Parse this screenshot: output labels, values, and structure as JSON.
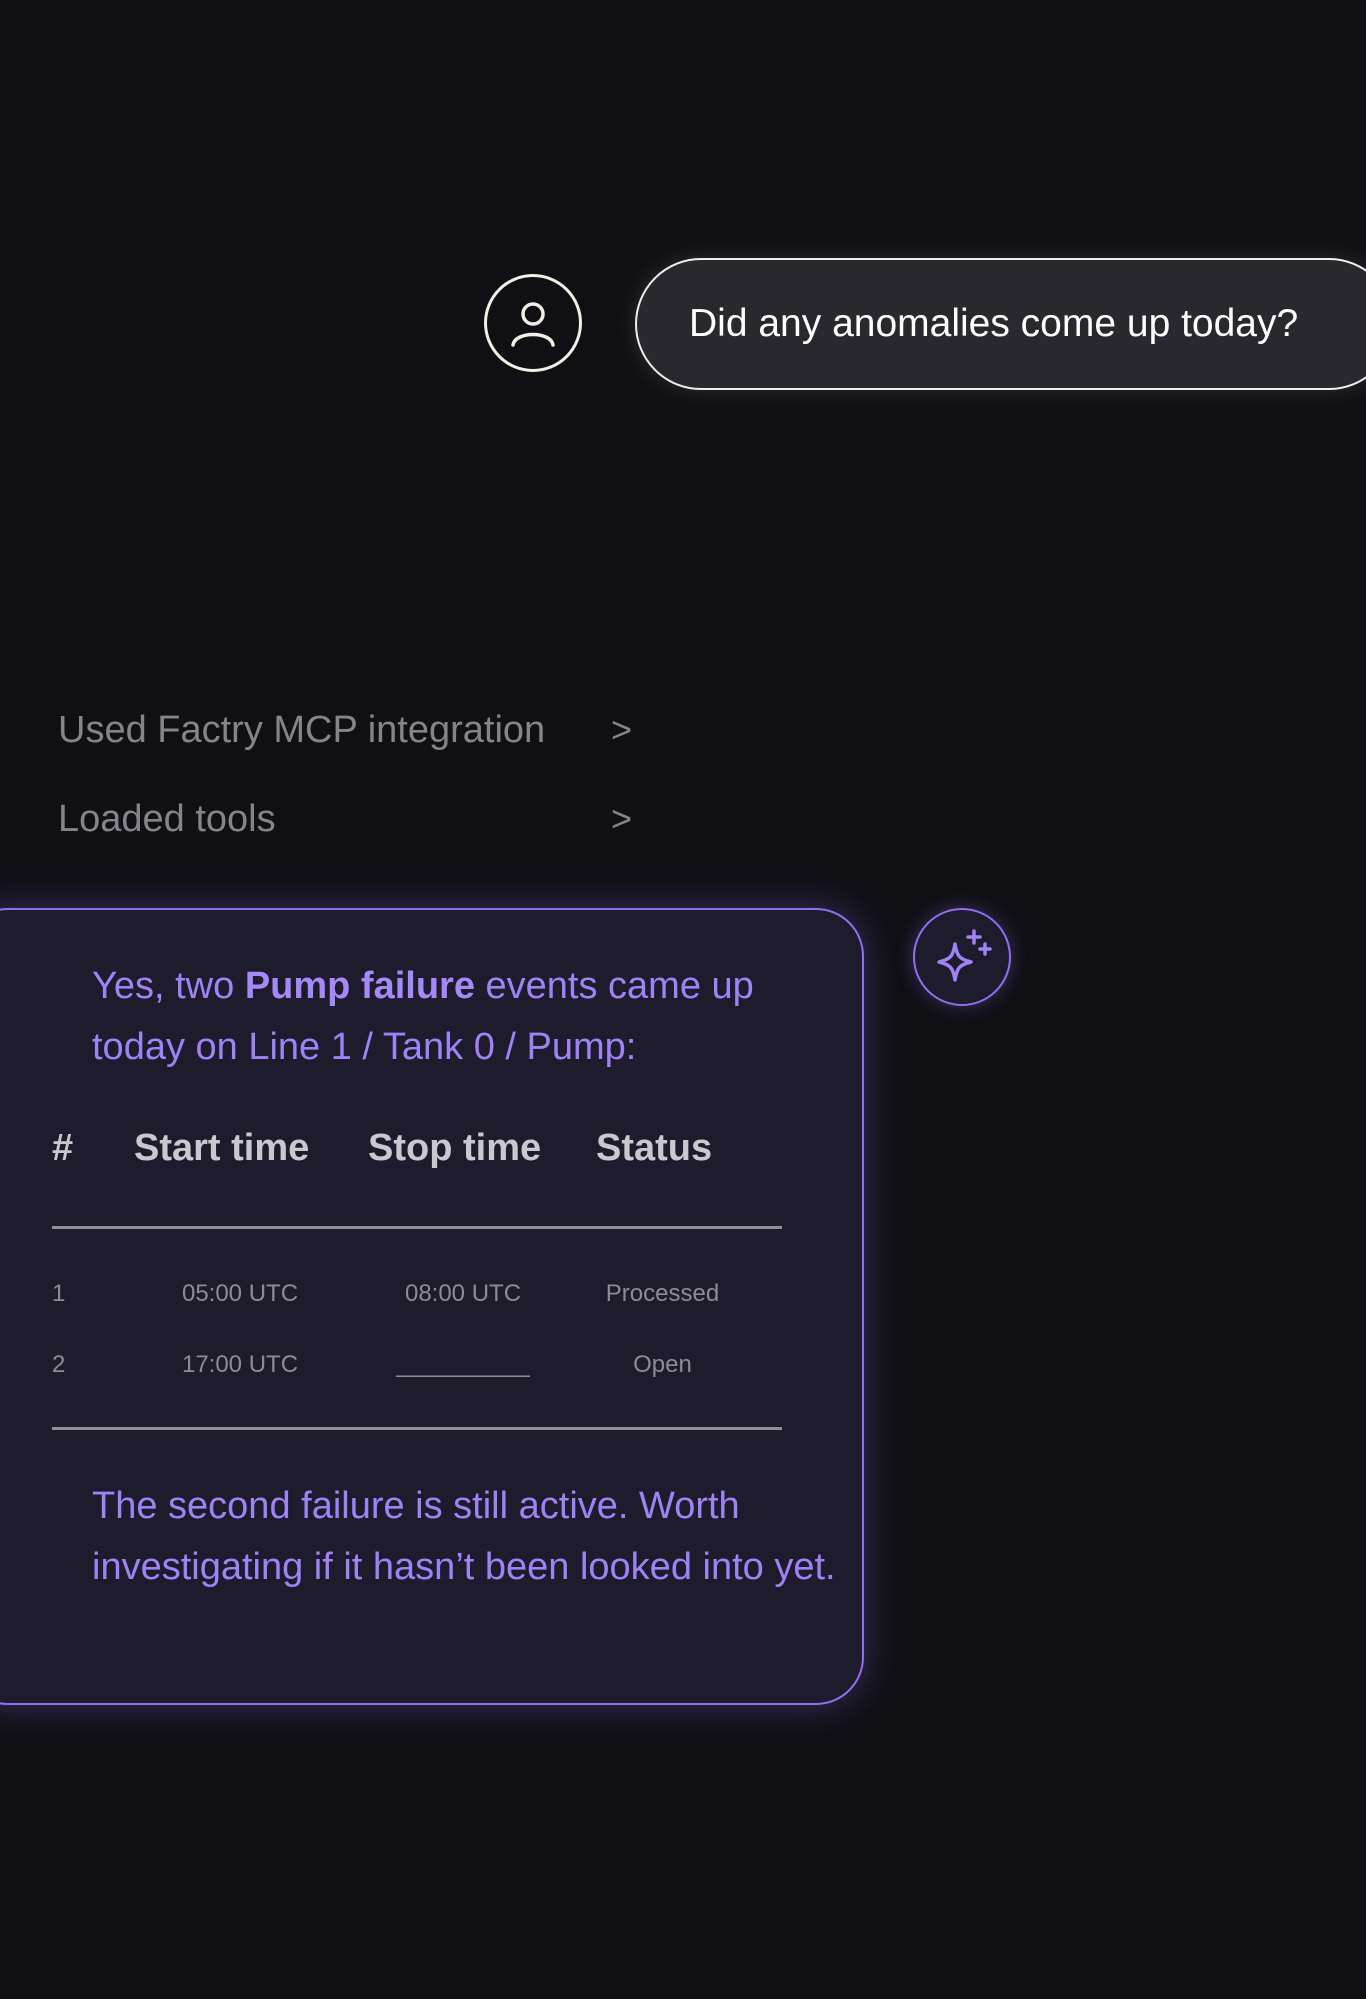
{
  "user_message": {
    "text": "Did any anomalies come up today?"
  },
  "tool_steps": [
    {
      "label": "Used Factry MCP integration",
      "chevron": ">"
    },
    {
      "label": "Loaded tools",
      "chevron": ">"
    }
  ],
  "assistant_message": {
    "intro_prefix": "Yes, two ",
    "intro_bold": "Pump failure",
    "intro_suffix": " events came up today on Line 1 / Tank 0 / Pump:",
    "table": {
      "headers": [
        "#",
        "Start time",
        "Stop time",
        "Status"
      ],
      "rows": [
        [
          "1",
          "05:00 UTC",
          "08:00 UTC",
          "Processed"
        ],
        [
          "2",
          "17:00 UTC",
          "__________",
          "Open"
        ]
      ]
    },
    "outro": "The second failure is still active.  Worth investigating if it hasn’t been looked into yet."
  },
  "icons": {
    "user_avatar": "user-icon",
    "assistant_avatar": "sparkle-icon"
  },
  "colors": {
    "background": "#100f14",
    "accent": "#8f6ff0",
    "accent_text": "#9f82f5"
  }
}
